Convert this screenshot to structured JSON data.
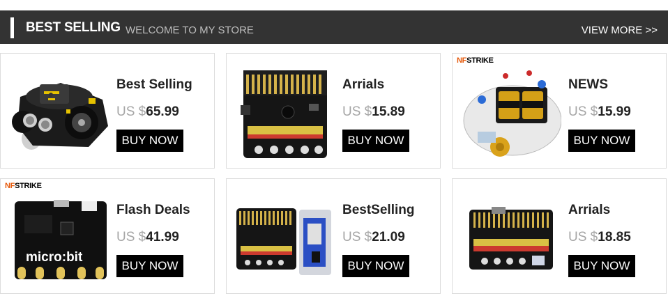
{
  "header": {
    "title": "BEST SELLING",
    "subtitle": "WELCOME TO MY STORE",
    "view_more": "VIEW MORE >>"
  },
  "products": [
    {
      "name": "Best Selling",
      "currency": "US $",
      "price": "65.99",
      "button": "BUY NOW",
      "image": "robot-car-image"
    },
    {
      "name": "Arrials",
      "currency": "US $",
      "price": "15.89",
      "button": "BUY NOW",
      "image": "expansion-board-image"
    },
    {
      "name": "NEWS",
      "currency": "US $",
      "price": "15.99",
      "button": "BUY NOW",
      "image": "robot-kit-image",
      "brand_nf": "NF",
      "brand_rest": "STRIKE"
    },
    {
      "name": "Flash Deals",
      "currency": "US $",
      "price": "41.99",
      "button": "BUY NOW",
      "image": "microbit-board-image",
      "brand_nf": "NF",
      "brand_rest": "STRIKE",
      "board_label": "micro:bit"
    },
    {
      "name": "BestSelling",
      "currency": "US $",
      "price": "21.09",
      "button": "BUY NOW",
      "image": "board-with-case-image"
    },
    {
      "name": "Arrials",
      "currency": "US $",
      "price": "18.85",
      "button": "BUY NOW",
      "image": "io-board-image"
    }
  ]
}
